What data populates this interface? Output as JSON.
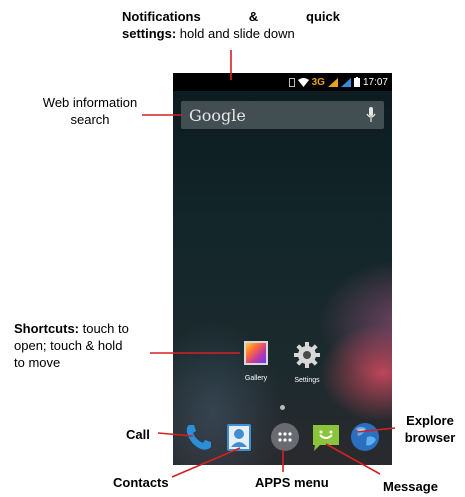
{
  "annotations": {
    "notifications_bold_1": "Notifications",
    "notifications_amp": "&",
    "notifications_bold_2": "quick",
    "notifications_bold_3": "settings:",
    "notifications_rest": " hold and slide down",
    "web_search_line1": "Web information",
    "web_search_line2": "search",
    "shortcuts_bold": "Shortcuts:",
    "shortcuts_rest1": " touch to",
    "shortcuts_line2": "open; touch & hold",
    "shortcuts_line3": "to move",
    "call": "Call",
    "contacts": "Contacts",
    "apps_menu": "APPS menu",
    "explore_line1": "Explore",
    "explore_line2": "browser",
    "message": "Message"
  },
  "phone": {
    "status": {
      "network": "3G",
      "time": "17:07"
    },
    "search": {
      "label": "Google",
      "mic_icon": "mic-icon"
    },
    "shortcuts": [
      {
        "label": "Gallery",
        "icon": "gallery-icon"
      },
      {
        "label": "Settings",
        "icon": "gear-icon"
      }
    ],
    "dock": [
      "phone-icon",
      "contacts-icon",
      "apps-grid-icon",
      "message-icon",
      "globe-icon"
    ]
  },
  "colors": {
    "callout_line": "#d62020",
    "network_accent": "#e8a020"
  }
}
